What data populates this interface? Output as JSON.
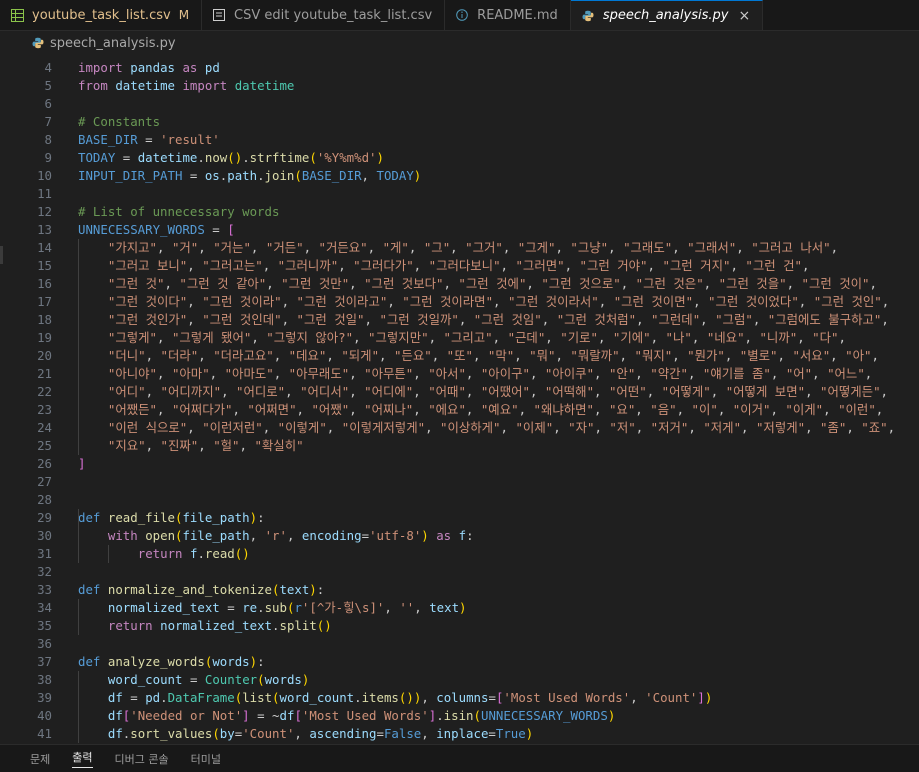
{
  "tabs": [
    {
      "label": "youtube_task_list.csv",
      "icon": "csv-table-icon",
      "modified": "M",
      "active": false
    },
    {
      "label": "CSV edit youtube_task_list.csv",
      "icon": "preview-icon",
      "active": false
    },
    {
      "label": "README.md",
      "icon": "info-icon",
      "active": false
    },
    {
      "label": "speech_analysis.py",
      "icon": "python-icon",
      "active": true,
      "close": "×"
    }
  ],
  "breadcrumb": {
    "file": "speech_analysis.py"
  },
  "editor": {
    "lines": [
      {
        "n": "4",
        "text": "import pandas as pd"
      },
      {
        "n": "5",
        "text": "from datetime import datetime"
      },
      {
        "n": "6",
        "text": ""
      },
      {
        "n": "7",
        "text": "# Constants"
      },
      {
        "n": "8",
        "text": "BASE_DIR = 'result'"
      },
      {
        "n": "9",
        "text": "TODAY = datetime.now().strftime('%Y%m%d')"
      },
      {
        "n": "10",
        "text": "INPUT_DIR_PATH = os.path.join(BASE_DIR, TODAY)"
      },
      {
        "n": "11",
        "text": ""
      },
      {
        "n": "12",
        "text": "# List of unnecessary words"
      },
      {
        "n": "13",
        "text": "UNNECESSARY_WORDS = ["
      },
      {
        "n": "14",
        "text": "    \"가지고\", \"거\", \"거는\", \"거든\", \"거든요\", \"게\", \"그\", \"그거\", \"그게\", \"그냥\", \"그래도\", \"그래서\", \"그러고 나서\","
      },
      {
        "n": "15",
        "text": "    \"그러고 보니\", \"그러고는\", \"그러니까\", \"그러다가\", \"그러다보니\", \"그러면\", \"그런 거야\", \"그런 거지\", \"그런 건\","
      },
      {
        "n": "16",
        "text": "    \"그런 것\", \"그런 것 같아\", \"그런 것만\", \"그런 것보다\", \"그런 것에\", \"그런 것으로\", \"그런 것은\", \"그런 것을\", \"그런 것이\","
      },
      {
        "n": "17",
        "text": "    \"그런 것이다\", \"그런 것이라\", \"그런 것이라고\", \"그런 것이라면\", \"그런 것이라서\", \"그런 것이면\", \"그런 것이었다\", \"그런 것인\","
      },
      {
        "n": "18",
        "text": "    \"그런 것인가\", \"그런 것인데\", \"그런 것일\", \"그런 것일까\", \"그런 것임\", \"그런 것처럼\", \"그런데\", \"그럼\", \"그럼에도 불구하고\","
      },
      {
        "n": "19",
        "text": "    \"그렇게\", \"그렇게 됐어\", \"그렇지 않아?\", \"그렇지만\", \"그리고\", \"근데\", \"기로\", \"기에\", \"나\", \"네요\", \"니까\", \"다\","
      },
      {
        "n": "20",
        "text": "    \"더니\", \"더라\", \"더라고요\", \"데요\", \"되게\", \"든요\", \"또\", \"막\", \"뭐\", \"뭐랄까\", \"뭐지\", \"뭔가\", \"별로\", \"서요\", \"아\","
      },
      {
        "n": "21",
        "text": "    \"아니야\", \"아마\", \"아마도\", \"아무래도\", \"아무튼\", \"아서\", \"아이구\", \"아이쿠\", \"안\", \"약간\", \"얘기를 좀\", \"어\", \"어느\","
      },
      {
        "n": "22",
        "text": "    \"어디\", \"어디까지\", \"어디로\", \"어디서\", \"어디에\", \"어때\", \"어땠어\", \"어떡해\", \"어떤\", \"어떻게\", \"어떻게 보면\", \"어떻게든\","
      },
      {
        "n": "23",
        "text": "    \"어쨌든\", \"어쩌다가\", \"어쩌면\", \"어쨌\", \"어찌나\", \"에요\", \"예요\", \"왜냐하면\", \"요\", \"음\", \"이\", \"이거\", \"이게\", \"이런\","
      },
      {
        "n": "24",
        "text": "    \"이런 식으로\", \"이런저런\", \"이렇게\", \"이렇게저렇게\", \"이상하게\", \"이제\", \"자\", \"저\", \"저거\", \"저게\", \"저렇게\", \"좀\", \"죠\","
      },
      {
        "n": "25",
        "text": "    \"지요\", \"진짜\", \"헐\", \"확실히\""
      },
      {
        "n": "26",
        "text": "]"
      },
      {
        "n": "27",
        "text": ""
      },
      {
        "n": "28",
        "text": ""
      },
      {
        "n": "29",
        "text": "def read_file(file_path):"
      },
      {
        "n": "30",
        "text": "    with open(file_path, 'r', encoding='utf-8') as f:"
      },
      {
        "n": "31",
        "text": "        return f.read()"
      },
      {
        "n": "32",
        "text": ""
      },
      {
        "n": "33",
        "text": "def normalize_and_tokenize(text):"
      },
      {
        "n": "34",
        "text": "    normalized_text = re.sub(r'[^가-힣\\s]', '', text)"
      },
      {
        "n": "35",
        "text": "    return normalized_text.split()"
      },
      {
        "n": "36",
        "text": ""
      },
      {
        "n": "37",
        "text": "def analyze_words(words):"
      },
      {
        "n": "38",
        "text": "    word_count = Counter(words)"
      },
      {
        "n": "39",
        "text": "    df = pd.DataFrame(list(word_count.items()), columns=['Most Used Words', 'Count'])"
      },
      {
        "n": "40",
        "text": "    df['Needed or Not'] = ~df['Most Used Words'].isin(UNNECESSARY_WORDS)"
      },
      {
        "n": "41",
        "text": "    df.sort_values(by='Count', ascending=False, inplace=True)"
      }
    ]
  },
  "panel": {
    "tabs": [
      {
        "label": "문제",
        "active": false
      },
      {
        "label": "출력",
        "active": true
      },
      {
        "label": "디버그 콘솔",
        "active": false
      },
      {
        "label": "터미널",
        "active": false
      }
    ]
  }
}
